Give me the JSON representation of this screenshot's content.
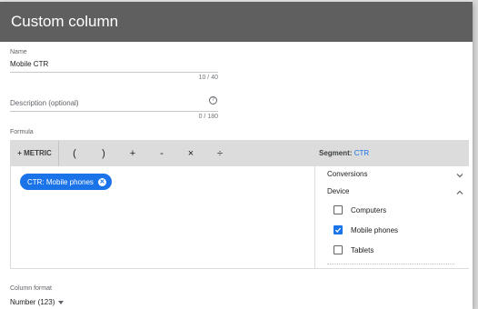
{
  "dialog": {
    "title": "Custom column"
  },
  "name": {
    "label": "Name",
    "value": "Mobile CTR",
    "counter": "10 / 40"
  },
  "description": {
    "label": "Description (optional)",
    "value": "",
    "counter": "0 / 180"
  },
  "formula": {
    "label": "Formula",
    "toolbar": {
      "metric_label": "+ METRIC",
      "operators": [
        "(",
        ")",
        "+",
        "-",
        "×",
        "÷"
      ],
      "segment_label": "Segment:",
      "segment_value": "CTR"
    },
    "chip_label": "CTR: Mobile phones"
  },
  "segment_panel": {
    "groups": [
      {
        "label": "Conversions",
        "expanded": false
      },
      {
        "label": "Device",
        "expanded": true
      }
    ],
    "options": [
      {
        "label": "Computers",
        "checked": false
      },
      {
        "label": "Mobile phones",
        "checked": true
      },
      {
        "label": "Tablets",
        "checked": false
      }
    ]
  },
  "column_format": {
    "label": "Column format",
    "value": "Number (123)"
  },
  "colors": {
    "header": "#5f5f5f",
    "accent": "#1a73e8",
    "toolbar": "#dcdcdc"
  }
}
